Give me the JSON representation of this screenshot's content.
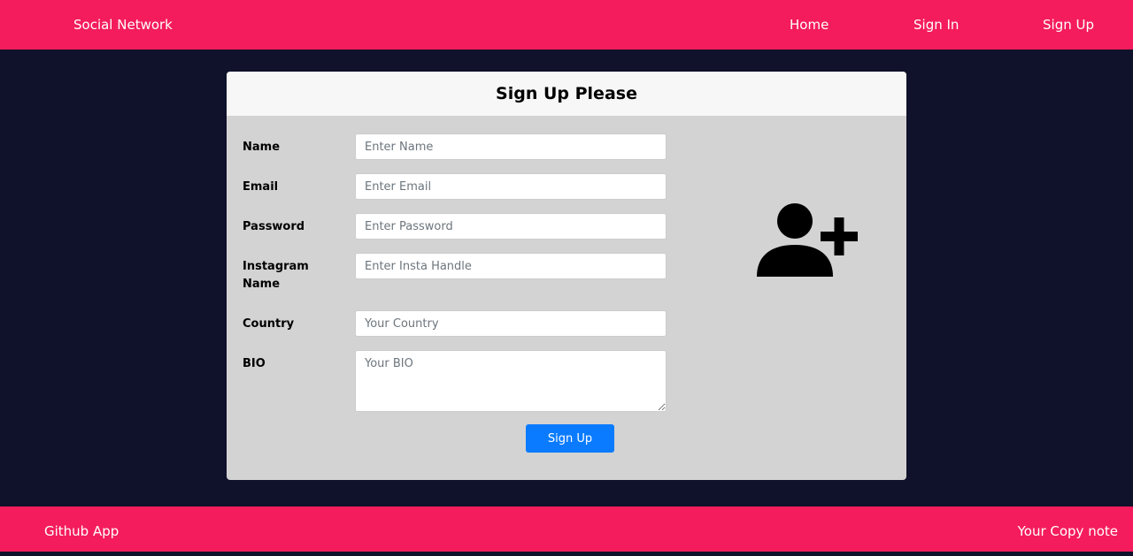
{
  "navbar": {
    "brand": "Social Network",
    "links": [
      "Home",
      "Sign In",
      "Sign Up"
    ],
    "background": "#f41c5c"
  },
  "form": {
    "title": "Sign Up Please",
    "fields": [
      {
        "label": "Name",
        "placeholder": "Enter Name",
        "value": ""
      },
      {
        "label": "Email",
        "placeholder": "Enter Email",
        "value": ""
      },
      {
        "label": "Password",
        "placeholder": "Enter Password",
        "value": ""
      },
      {
        "label": "Instagram Name",
        "placeholder": "Enter Insta Handle",
        "value": ""
      },
      {
        "label": "Country",
        "placeholder": "Your Country",
        "value": ""
      },
      {
        "label": "BIO",
        "placeholder": "Your BIO",
        "value": ""
      }
    ],
    "submit_label": "Sign Up",
    "icon": "user-plus-icon",
    "submit_color": "#0a7bff"
  },
  "footer": {
    "left_link": "Github App",
    "right_text": "Your Copy note"
  }
}
